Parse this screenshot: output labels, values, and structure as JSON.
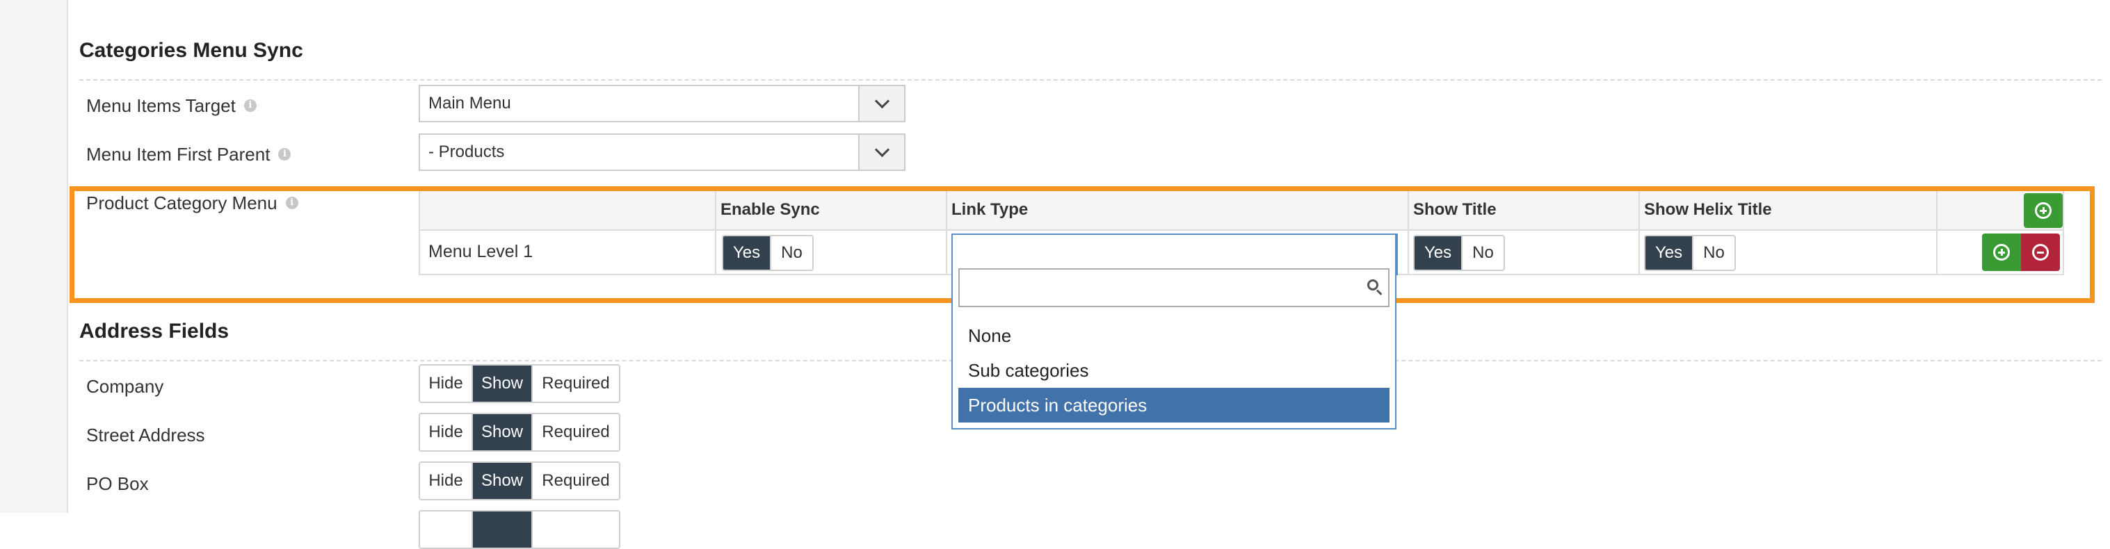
{
  "categories_menu_sync": {
    "title": "Categories Menu Sync",
    "menu_items_target": {
      "label": "Menu Items Target",
      "value": "Main Menu"
    },
    "menu_item_first_parent": {
      "label": "Menu Item First Parent",
      "value": "- Products"
    },
    "product_category_menu": {
      "label": "Product Category Menu",
      "headers": [
        "Enable Sync",
        "Link Type",
        "Show Title",
        "Show Helix Title"
      ],
      "row": {
        "level": "Menu Level 1",
        "enable_sync": {
          "yes": "Yes",
          "no": "No",
          "selected": "Yes"
        },
        "link_type": "Products in categories",
        "show_title": {
          "yes": "Yes",
          "no": "No",
          "selected": "Yes"
        },
        "show_helix_title": {
          "yes": "Yes",
          "no": "No",
          "selected": "Yes"
        }
      }
    }
  },
  "link_type_dropdown": {
    "search_placeholder": "",
    "options": [
      "None",
      "Sub categories",
      "Products in categories"
    ],
    "selected": "Products in categories"
  },
  "address_fields": {
    "title": "Address Fields",
    "option_labels": {
      "hide": "Hide",
      "show": "Show",
      "required": "Required"
    },
    "fields": [
      {
        "label": "Company",
        "selected": "Show"
      },
      {
        "label": "Street Address",
        "selected": "Show"
      },
      {
        "label": "PO Box",
        "selected": "Show"
      }
    ]
  },
  "colors": {
    "highlight": "#f7931e",
    "toggle_active": "#33414e",
    "add_button": "#3a9a33",
    "remove_button": "#b2243a",
    "selected_option": "#4272aa"
  },
  "icons": [
    "info-icon",
    "chevron-down-icon",
    "plus-circle-icon",
    "minus-circle-icon",
    "search-icon"
  ]
}
